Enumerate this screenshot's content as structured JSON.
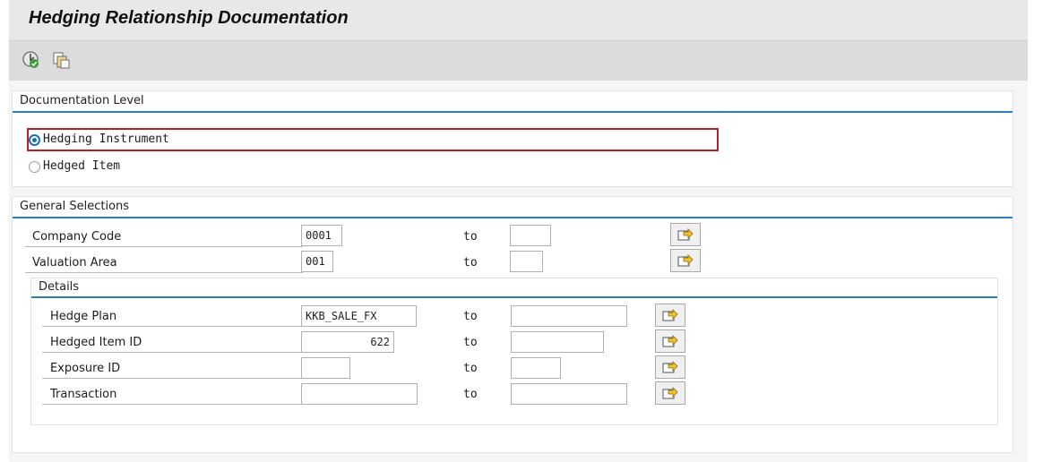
{
  "header": {
    "title": "Hedging Relationship Documentation"
  },
  "toolbar": {
    "icons": [
      "execute-icon",
      "multiple-selection-icon"
    ]
  },
  "documentation_level": {
    "title": "Documentation Level",
    "options": [
      {
        "label": "Hedging Instrument",
        "selected": true
      },
      {
        "label": "Hedged Item",
        "selected": false
      }
    ]
  },
  "general_selections": {
    "title": "General Selections",
    "to_label": "to",
    "fields": [
      {
        "label": "Company Code",
        "from": "0001",
        "to": ""
      },
      {
        "label": "Valuation Area",
        "from": "001",
        "to": ""
      }
    ],
    "details": {
      "title": "Details",
      "fields": [
        {
          "label": "Hedge Plan",
          "from": "KKB_SALE_FX",
          "to": ""
        },
        {
          "label": "Hedged Item ID",
          "from": "622",
          "to": ""
        },
        {
          "label": "Exposure ID",
          "from": "",
          "to": ""
        },
        {
          "label": "Transaction",
          "from": "",
          "to": ""
        }
      ]
    }
  },
  "colors": {
    "accent": "#2e7fb8",
    "highlight": "#b22222",
    "toolbar_bg": "#dcdcdc"
  }
}
